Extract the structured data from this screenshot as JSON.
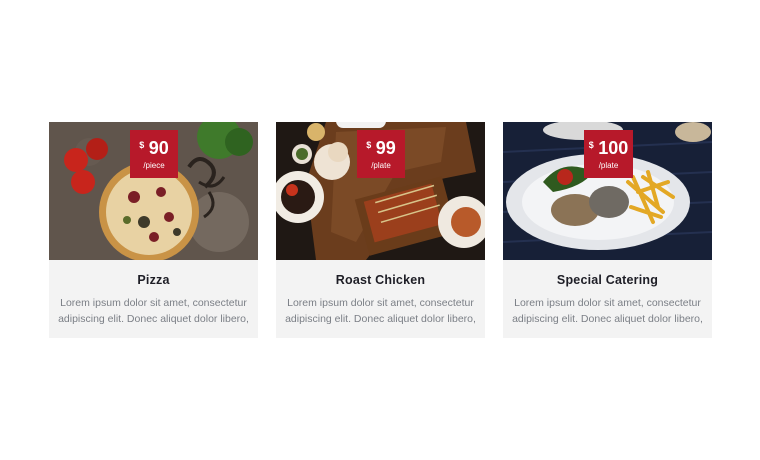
{
  "cards": [
    {
      "title": "Pizza",
      "currency": "$",
      "price": "90",
      "unit": "/piece",
      "description": "Lorem ipsum dolor sit amet, consectetur adipiscing elit. Donec aliquet dolor libero,"
    },
    {
      "title": "Roast Chicken",
      "currency": "$",
      "price": "99",
      "unit": "/plate",
      "description": "Lorem ipsum dolor sit amet, consectetur adipiscing elit. Donec aliquet dolor libero,"
    },
    {
      "title": "Special Catering",
      "currency": "$",
      "price": "100",
      "unit": "/plate",
      "description": "Lorem ipsum dolor sit amet, consectetur adipiscing elit. Donec aliquet dolor libero,"
    }
  ],
  "colors": {
    "badge": "#b7192a",
    "card_bg": "#f3f3f3",
    "title": "#1e1e26",
    "text": "#7b7f86"
  }
}
